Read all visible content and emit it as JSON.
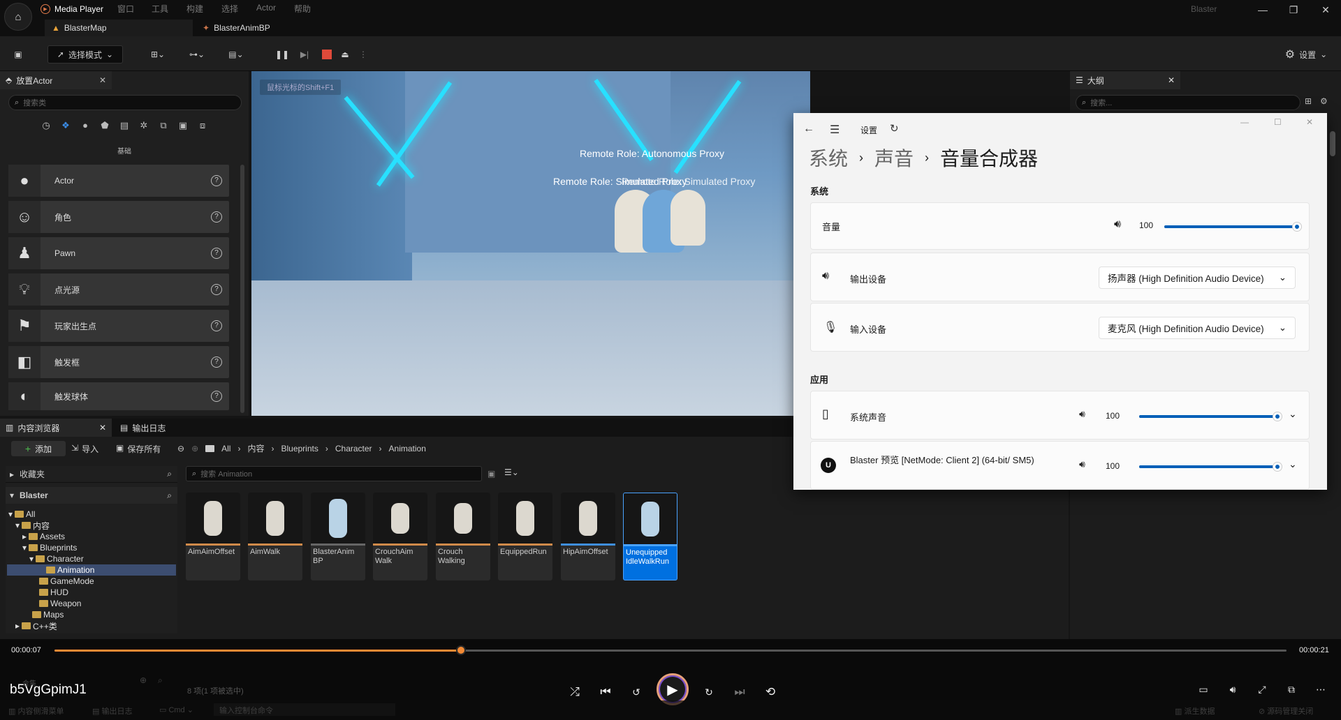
{
  "titlebar": {
    "app_title": "Media Player",
    "menus": [
      "窗口",
      "工具",
      "构建",
      "选择",
      "Actor",
      "帮助"
    ],
    "project": "Blaster",
    "tabs": [
      "BlasterMap",
      "BlasterAnimBP"
    ],
    "window_buttons": [
      "—",
      "❐",
      "✕"
    ]
  },
  "toolbar": {
    "select_mode": "选择模式",
    "settings": "设置"
  },
  "place_actor": {
    "title": "放置Actor",
    "search_placeholder": "搜索类",
    "category": "基础",
    "items": [
      {
        "label": "Actor",
        "icon": "sphere-icon"
      },
      {
        "label": "角色",
        "icon": "character-icon"
      },
      {
        "label": "Pawn",
        "icon": "pawn-icon"
      },
      {
        "label": "点光源",
        "icon": "lightbulb-icon"
      },
      {
        "label": "玩家出生点",
        "icon": "player-start-icon"
      },
      {
        "label": "触发框",
        "icon": "trigger-box-icon"
      },
      {
        "label": "触发球体",
        "icon": "trigger-sphere-icon"
      }
    ]
  },
  "viewport": {
    "hint": "鼠标光标的Shift+F1",
    "label1": "Remote Role: Autonomous Proxy",
    "label2a": "Remote Role: Simulated Proxy",
    "label2b": "Remote Role: Simulated Proxy"
  },
  "outliner": {
    "title": "大纲",
    "search_placeholder": "搜索..."
  },
  "content_browser": {
    "tab1": "内容浏览器",
    "tab2": "输出日志",
    "add": "添加",
    "import": "导入",
    "save_all": "保存所有",
    "path": [
      "All",
      "内容",
      "Blueprints",
      "Character",
      "Animation"
    ],
    "favorites": "收藏夹",
    "project": "Blaster",
    "search_placeholder": "搜索 Animation",
    "tree": [
      "All",
      "内容",
      "Assets",
      "Blueprints",
      "Character",
      "Animation",
      "GameMode",
      "HUD",
      "Weapon",
      "Maps",
      "C++类"
    ],
    "assets": [
      "AimAimOffset",
      "AimWalk",
      "BlasterAnim BP",
      "CrouchAim Walk",
      "Crouch Walking",
      "EquippedRun",
      "HipAimOffset",
      "Unequipped IdleWalkRun"
    ],
    "status": "8 项(1 项被选中)",
    "collections": "合集"
  },
  "bottom_bar": {
    "drawer": "内容侧滑菜单",
    "output": "输出日志",
    "cmd": "Cmd",
    "cmd_placeholder": "输入控制台命令",
    "derived": "派生数据",
    "source_control": "源码管理关闭"
  },
  "settings": {
    "nav": "设置",
    "crumb1": "系统",
    "crumb2": "声音",
    "crumb3": "音量合成器",
    "section_system": "系统",
    "volume_label": "音量",
    "volume_value": "100",
    "volume": 1.0,
    "output_label": "输出设备",
    "output_device": "扬声器 (High Definition Audio Device)",
    "input_label": "输入设备",
    "input_device": "麦克风 (High Definition Audio Device)",
    "section_apps": "应用",
    "app1": "系统声音",
    "app1_value": "100",
    "app2": "Blaster 预览 [NetMode: Client 2]   (64-bit/ SM5)",
    "app2_value": "100"
  },
  "player": {
    "title": "b5VgGpimJ1",
    "elapsed": "00:00:07",
    "total": "00:00:21",
    "progress": 0.33
  },
  "colors": {
    "accent_orange": "#f28a35",
    "win_blue": "#005fb8",
    "selected": "#0070e0",
    "stop_red": "#e04a3a"
  }
}
